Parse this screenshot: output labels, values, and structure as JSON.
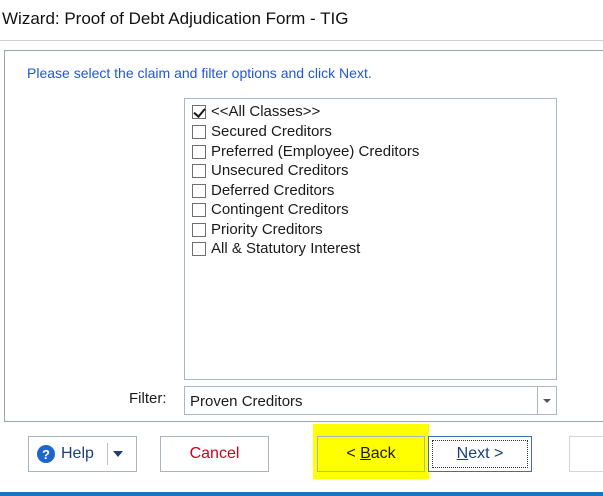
{
  "window": {
    "title": "Wizard: Proof of Debt Adjudication Form - TIG"
  },
  "instruction": "Please select the claim and filter options and click Next.",
  "classes": [
    {
      "label": "<<All Classes>>",
      "checked": true
    },
    {
      "label": "Secured Creditors",
      "checked": false
    },
    {
      "label": "Preferred (Employee) Creditors",
      "checked": false
    },
    {
      "label": "Unsecured Creditors",
      "checked": false
    },
    {
      "label": "Deferred Creditors",
      "checked": false
    },
    {
      "label": "Contingent Creditors",
      "checked": false
    },
    {
      "label": "Priority Creditors",
      "checked": false
    },
    {
      "label": "All & Statutory Interest",
      "checked": false
    }
  ],
  "filter": {
    "label": "Filter:",
    "value": "Proven Creditors"
  },
  "buttons": {
    "help": "Help",
    "cancel": "Cancel",
    "back_prefix": "< ",
    "back_hotkey": "B",
    "back_rest": "ack",
    "next_hotkey": "N",
    "next_rest": "ext",
    "next_suffix": " >"
  },
  "colors": {
    "instruction": "#1f58d6",
    "cancel": "#d0021b",
    "highlight": "#ffff00",
    "accent": "#1e73be"
  }
}
